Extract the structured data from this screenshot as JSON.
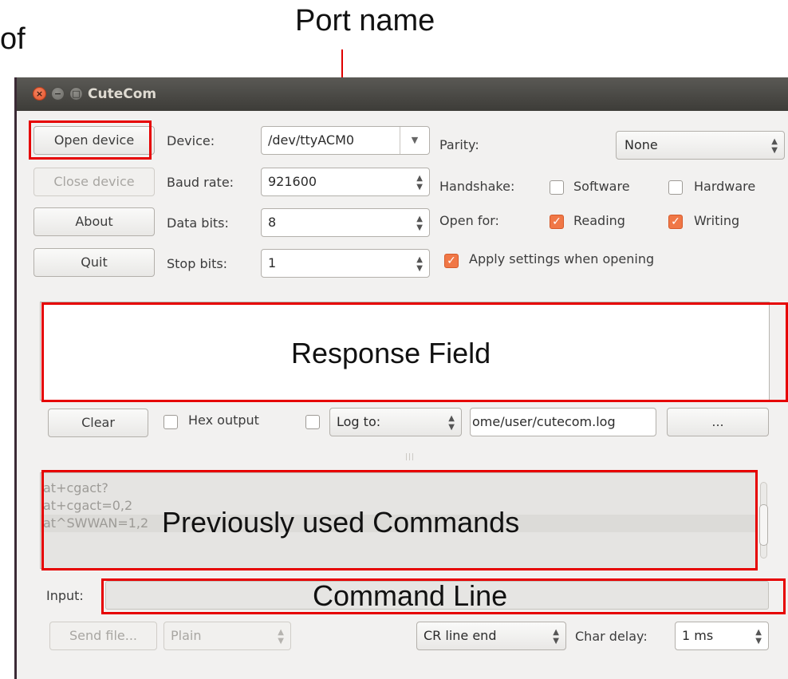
{
  "annotations": {
    "port_name": "Port name",
    "response_field": "Response Field",
    "previous_commands": "Previously used Commands",
    "command_line": "Command Line",
    "cut_text": "of"
  },
  "window": {
    "title": "CuteCom",
    "close_glyph": "×",
    "min_glyph": "−",
    "max_glyph": "□"
  },
  "buttons": {
    "open_device": "Open device",
    "close_device": "Close device",
    "about": "About",
    "quit": "Quit",
    "clear": "Clear",
    "browse": "...",
    "send_file": "Send file..."
  },
  "settings": {
    "device_label": "Device:",
    "device_value": "/dev/ttyACM0",
    "baud_label": "Baud rate:",
    "baud_value": "921600",
    "data_bits_label": "Data bits:",
    "data_bits_value": "8",
    "stop_bits_label": "Stop bits:",
    "stop_bits_value": "1",
    "parity_label": "Parity:",
    "parity_value": "None",
    "handshake_label": "Handshake:",
    "software_label": "Software",
    "hardware_label": "Hardware",
    "open_for_label": "Open for:",
    "reading_label": "Reading",
    "writing_label": "Writing",
    "apply_label": "Apply settings when opening"
  },
  "checks": {
    "software": false,
    "hardware": false,
    "reading": true,
    "writing": true,
    "apply": true,
    "hex_output": false,
    "log": false
  },
  "output_bar": {
    "hex_output_label": "Hex output",
    "log_mode": "Log to:",
    "log_path": "ome/user/cutecom.log"
  },
  "history": [
    "at+cgact?",
    "at+cgact=0,2",
    "at^SWWAN=1,2"
  ],
  "input": {
    "label": "Input:",
    "value": ""
  },
  "bottom": {
    "send_mode": "Plain",
    "line_end": "CR line end",
    "char_delay_label": "Char delay:",
    "char_delay_value": "1 ms"
  },
  "colors": {
    "annotation_red": "#e60000",
    "checkbox_orange": "#f07746",
    "titlebar": "#3d3c38"
  }
}
